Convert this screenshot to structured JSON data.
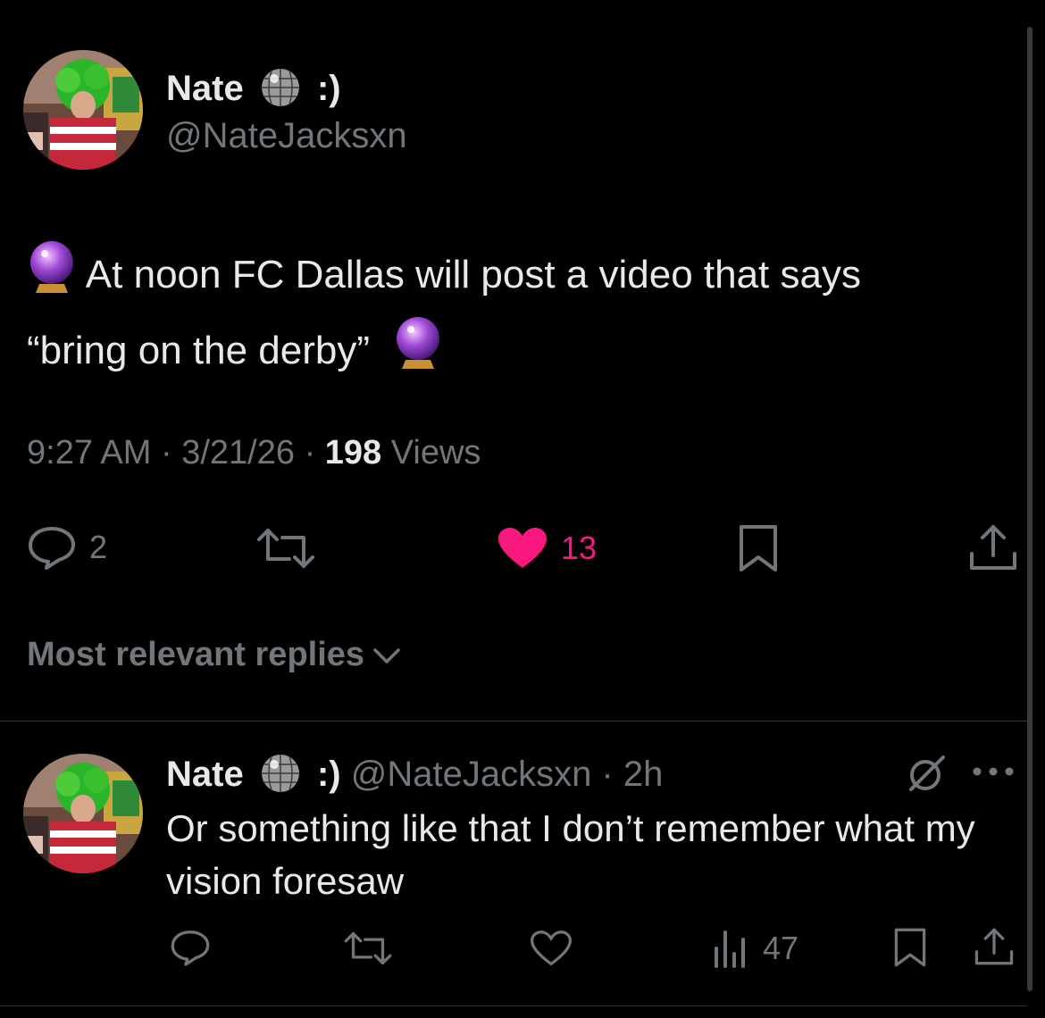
{
  "tweet": {
    "author_name": "Nate",
    "author_suffix": ":)",
    "handle": "@NateJacksxn",
    "text_line1": "At noon FC Dallas will post a video that says",
    "text_line2": "“bring on the derby”",
    "time": "9:27 AM",
    "date": "3/21/26",
    "views_count": "198",
    "views_label": "Views",
    "separator": "·",
    "replies_count": "2",
    "likes_count": "13",
    "liked": true
  },
  "sort": {
    "label": "Most relevant replies"
  },
  "reply": {
    "author_name": "Nate",
    "author_suffix": ":)",
    "handle_time": "@NateJacksxn · 2h",
    "text": "Or something like that I don’t remember what my vision foresaw",
    "views_count": "47"
  },
  "colors": {
    "background": "#000000",
    "primary_text": "#e7e9ea",
    "secondary_text": "#71767b",
    "like_pink": "#f91880"
  },
  "icons": [
    "disco-ball-icon",
    "crystal-ball-icon",
    "reply-icon",
    "retweet-icon",
    "heart-icon",
    "bookmark-icon",
    "share-icon",
    "chevron-down-icon",
    "grok-icon",
    "more-icon",
    "views-icon"
  ]
}
